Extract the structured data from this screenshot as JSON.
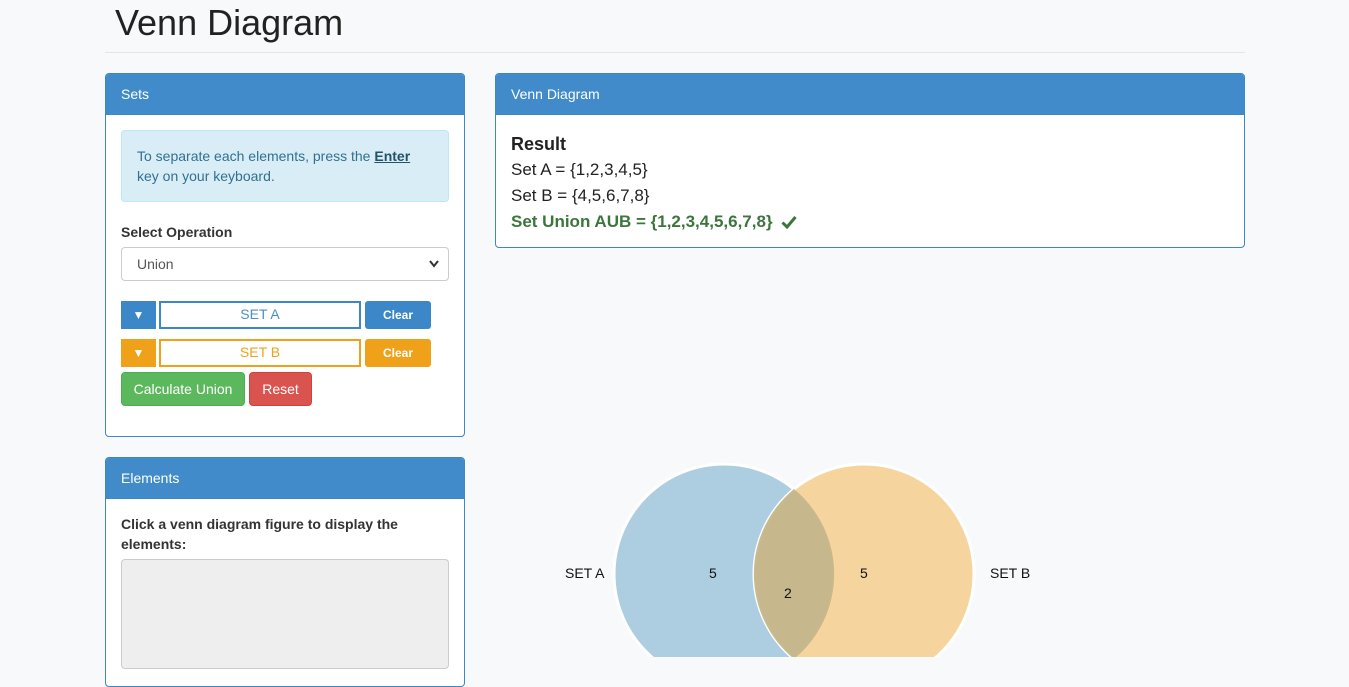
{
  "page": {
    "title": "Venn Diagram"
  },
  "sets_panel": {
    "heading": "Sets",
    "info_text_before": "To separate each elements, press the ",
    "info_link": "Enter",
    "info_text_after": " key on your keyboard.",
    "operation_label": "Select Operation",
    "operation_selected": "Union",
    "set_a": {
      "dropdown_icon": "▼",
      "placeholder": "SET A",
      "clear_label": "Clear",
      "color": "#3c87c7"
    },
    "set_b": {
      "dropdown_icon": "▼",
      "placeholder": "SET B",
      "clear_label": "Clear",
      "color": "#f0a11a"
    },
    "calculate_label": "Calculate Union",
    "reset_label": "Reset"
  },
  "elements_panel": {
    "heading": "Elements",
    "instruction": "Click a venn diagram figure to display the elements:"
  },
  "venn_panel": {
    "heading": "Venn Diagram",
    "result_title": "Result",
    "set_a_line": "Set A = {1,2,3,4,5}",
    "set_b_line": "Set B = {4,5,6,7,8}",
    "union_line": "Set Union AUB = {1,2,3,4,5,6,7,8}",
    "union_icon": "check-icon"
  },
  "venn_diagram": {
    "label_a": "SET A",
    "label_b": "SET B",
    "only_a_count": "5",
    "only_b_count": "5",
    "intersection_count": "2",
    "color_a": "#9ac2da",
    "color_b": "#f5c77e"
  }
}
